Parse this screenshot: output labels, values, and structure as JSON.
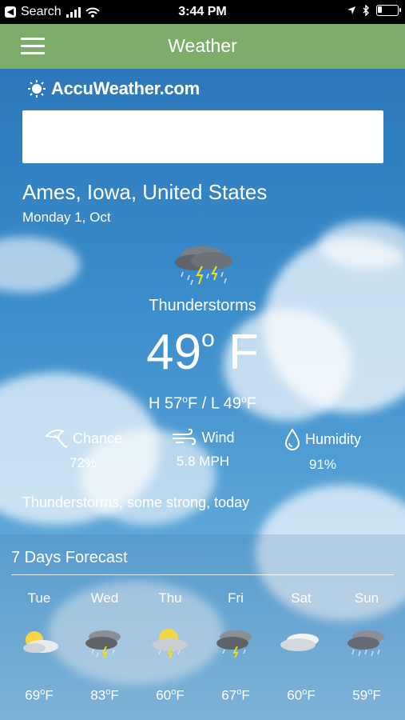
{
  "status_bar": {
    "back_label": "Search",
    "time": "3:44 PM"
  },
  "app_bar": {
    "title": "Weather",
    "menu_icon": "hamburger-icon"
  },
  "brand": {
    "name": "AccuWeather.com"
  },
  "current": {
    "location": "Ames, Iowa, United States",
    "date": "Monday 1, Oct",
    "condition": "Thunderstorms",
    "temperature": "49",
    "temp_unit": "F",
    "degree": "o",
    "high": "57",
    "low": "49",
    "hilo_prefix_h": "H ",
    "hilo_unit": "F",
    "hilo_sep": " / L ",
    "summary": "Thunderstorms, some strong, today"
  },
  "stats": [
    {
      "label": "Chance",
      "value": "72%",
      "icon": "umbrella-icon"
    },
    {
      "label": "Wind",
      "value": "5.8 MPH",
      "icon": "wind-icon"
    },
    {
      "label": "Humidity",
      "value": "91%",
      "icon": "droplet-icon"
    }
  ],
  "forecast": {
    "title": "7 Days Forecast",
    "days": [
      {
        "day": "Tue",
        "temp": "69",
        "unit": "F",
        "icon": "partly-sunny-icon"
      },
      {
        "day": "Wed",
        "temp": "83",
        "unit": "F",
        "icon": "thunderstorm-icon"
      },
      {
        "day": "Thu",
        "temp": "60",
        "unit": "F",
        "icon": "sun-thunderstorm-icon"
      },
      {
        "day": "Fri",
        "temp": "67",
        "unit": "F",
        "icon": "thunderstorm-icon"
      },
      {
        "day": "Sat",
        "temp": "60",
        "unit": "F",
        "icon": "cloudy-icon"
      },
      {
        "day": "Sun",
        "temp": "59",
        "unit": "F",
        "icon": "rain-icon"
      }
    ]
  },
  "colors": {
    "app_bar": "#7eac6a",
    "sky": "#2d78bb"
  }
}
